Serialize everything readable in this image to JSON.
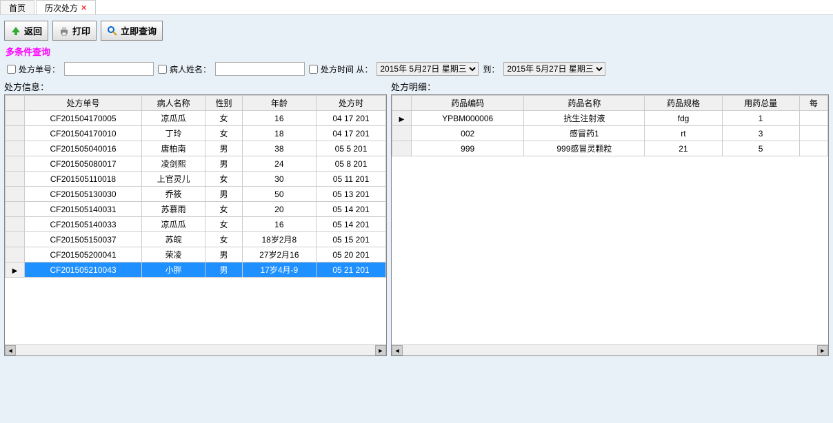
{
  "tabs": {
    "home": "首页",
    "history": "历次处方"
  },
  "toolbar": {
    "back": "返回",
    "print": "打印",
    "query": "立即查询"
  },
  "query_title": "多条件查询",
  "filters": {
    "rx_no_label": "处方单号：",
    "patient_name_label": "病人姓名：",
    "rx_time_from_label": "处方时间 从：",
    "to_label": "到：",
    "date_from": "2015年 5月27日 星期三",
    "date_to": "2015年 5月27日 星期三"
  },
  "left_title": "处方信息：",
  "right_title": "处方明细：",
  "left_headers": {
    "rxno": "处方单号",
    "name": "病人名称",
    "gender": "性别",
    "age": "年龄",
    "time": "处方时"
  },
  "left_rows": [
    {
      "rxno": "CF201504170005",
      "name": "凉瓜瓜",
      "gender": "女",
      "age": "16",
      "time": "04 17 201"
    },
    {
      "rxno": "CF201504170010",
      "name": "丁玲",
      "gender": "女",
      "age": "18",
      "time": "04 17 201"
    },
    {
      "rxno": "CF201505040016",
      "name": "唐柏南",
      "gender": "男",
      "age": "38",
      "time": "05  5 201"
    },
    {
      "rxno": "CF201505080017",
      "name": "凌剑熙",
      "gender": "男",
      "age": "24",
      "time": "05  8 201"
    },
    {
      "rxno": "CF201505110018",
      "name": "上官灵儿",
      "gender": "女",
      "age": "30",
      "time": "05 11 201"
    },
    {
      "rxno": "CF201505130030",
      "name": "乔筱",
      "gender": "男",
      "age": "50",
      "time": "05 13 201"
    },
    {
      "rxno": "CF201505140031",
      "name": "苏慕雨",
      "gender": "女",
      "age": "20",
      "time": "05 14 201"
    },
    {
      "rxno": "CF201505140033",
      "name": "凉瓜瓜",
      "gender": "女",
      "age": "16",
      "time": "05 14 201"
    },
    {
      "rxno": "CF201505150037",
      "name": "苏皖",
      "gender": "女",
      "age": "18岁2月8",
      "time": "05 15 201"
    },
    {
      "rxno": "CF201505200041",
      "name": "荣凌",
      "gender": "男",
      "age": "27岁2月16",
      "time": "05 20 201"
    },
    {
      "rxno": "CF201505210043",
      "name": "小胖",
      "gender": "男",
      "age": "17岁4月-9",
      "time": "05 21 201",
      "selected": true
    }
  ],
  "right_headers": {
    "code": "药品编码",
    "dname": "药品名称",
    "spec": "药品规格",
    "qty": "用药总量",
    "per": "每"
  },
  "right_rows": [
    {
      "code": "YPBM000006",
      "dname": "抗生注射液",
      "spec": "fdg",
      "qty": "1"
    },
    {
      "code": "002",
      "dname": "感冒药1",
      "spec": "rt",
      "qty": "3"
    },
    {
      "code": "999",
      "dname": "999感冒灵颗粒",
      "spec": "21",
      "qty": "5"
    }
  ]
}
